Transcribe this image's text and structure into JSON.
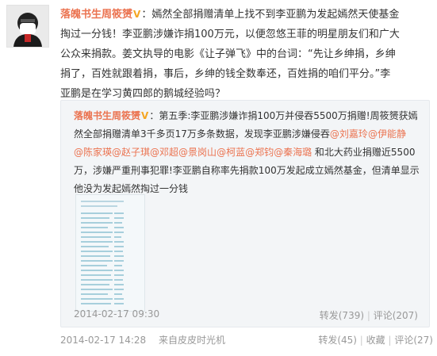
{
  "post": {
    "author": "落魄书生周筱赟",
    "body": [
      "：嫣然全部捐赠清单上找不到李亚鹏为发起嫣然天使基金",
      "掏过一分钱！李亚鹏涉嫌诈捐100万元，以便忽悠王菲的明星朋友们和广大",
      "公众来捐款。姜文执导的电影《让子弹飞》中的台词：“先让乡绅捐，乡绅",
      "捐了，百姓就跟着捐，事后，乡绅的钱全数奉还，百姓捐的咱们平分。”李",
      "亚鹏是在学习黄四郎的鹅城经验吗？"
    ],
    "timestamp": "2014-02-17 14:28",
    "source": "来自皮皮时光机",
    "actions": {
      "repost": "转发(45)",
      "favorite": "收藏",
      "comment": "评论(27)"
    }
  },
  "repost": {
    "author": "落魄书生周筱赟",
    "line1_pre": "：第五季:李亚鹏涉嫌诈捐100万并侵吞5500万捐赠!周筱赟获嫣",
    "line2": "然全部捐赠清单3千多页17万多条数据，发现李亚鹏涉嫌侵吞",
    "mentions_line2": [
      "@刘嘉玲",
      "@伊能静"
    ],
    "mentions_line3": [
      "@陈家瑛",
      "@赵子琪",
      "@邓超",
      "@景岗山",
      "@柯蓝",
      "@郑钧",
      "@秦海璐"
    ],
    "line3_post": " 和北大药业捐赠近5500",
    "line4": "万，涉嫌严重刑事犯罪!李亚鹏自称率先捐款100万发起成立嫣然基金，但清单显示",
    "line5": "他没为发起嫣然掏过一分钱",
    "timestamp": "2014-02-17 09:30",
    "actions": {
      "repost": "转发(739)",
      "comment": "评论(207)"
    }
  },
  "colors": {
    "accent": "#eb7350",
    "badge": "#f5a623",
    "muted": "#999999",
    "card_bg": "#f3f5f7"
  },
  "icons": {
    "avatar": "avatar-photo",
    "verified": "verified-v-icon",
    "thumbnail": "document-thumbnail"
  }
}
